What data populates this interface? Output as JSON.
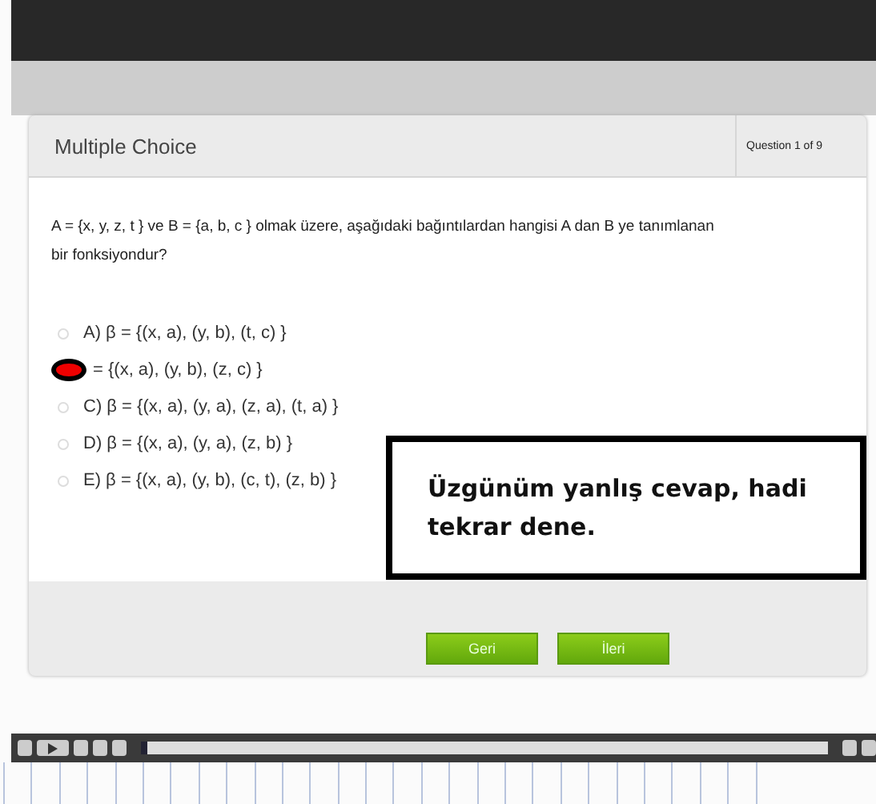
{
  "card": {
    "title": "Multiple Choice",
    "counter": "Question 1 of 9"
  },
  "question": "A = {x, y, z, t } ve B = {a, b, c } olmak üzere, aşağıdaki bağıntılardan hangisi A dan B ye tanımlanan bir fonksiyondur?",
  "options": [
    {
      "text": "A) β = {(x, a), (y, b), (t, c) }",
      "selected": false
    },
    {
      "text": "= {(x, a), (y, b), (z, c) }",
      "selected": true
    },
    {
      "text": "C) β = {(x, a), (y, a), (z, a), (t, a) }",
      "selected": false
    },
    {
      "text": "D) β = {(x, a), (y, a), (z, b) }",
      "selected": false
    },
    {
      "text": "E) β = {(x, a), (y, b), (c, t), (z, b) }",
      "selected": false
    }
  ],
  "buttons": [
    "Geri",
    "İleri"
  ],
  "feedback": "Üzgünüm yanlış cevap, hadi tekrar dene.",
  "player": {
    "level": 0
  }
}
